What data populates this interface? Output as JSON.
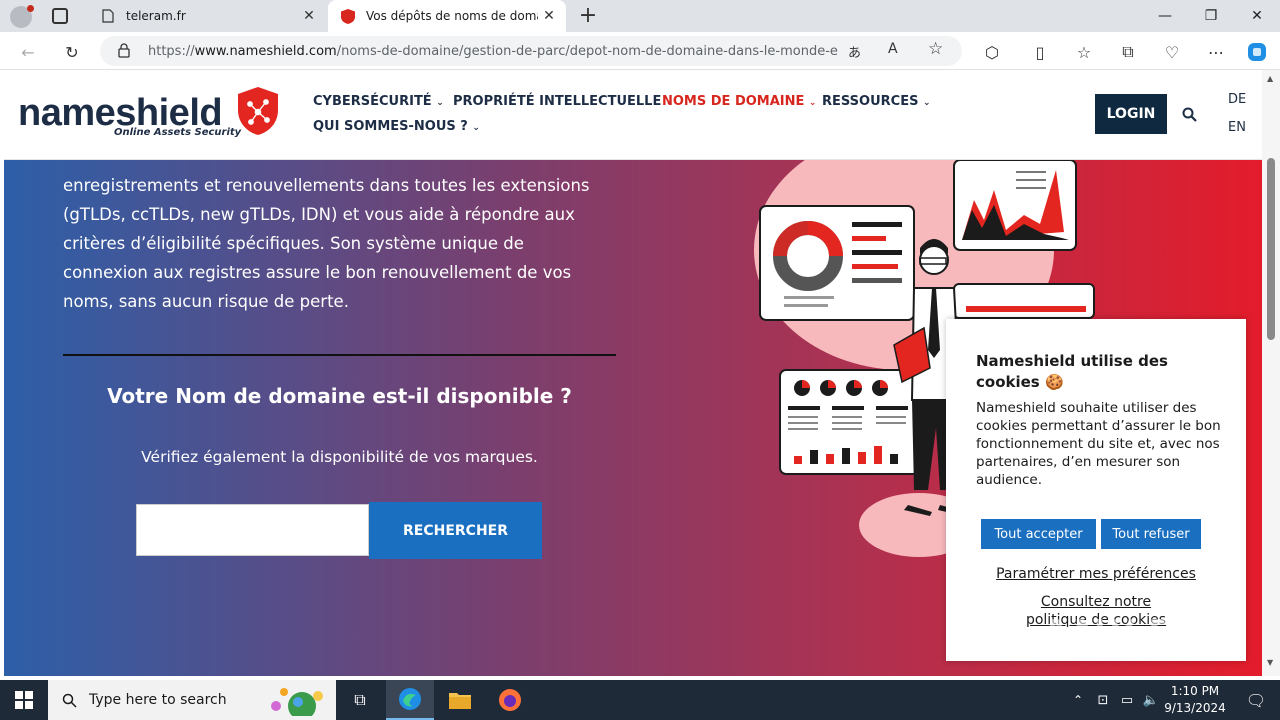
{
  "browser": {
    "tabs": [
      {
        "title": "teleram.fr",
        "active": false
      },
      {
        "title": "Vos dépôts de noms de domaine",
        "active": true
      }
    ],
    "new_tab": "+",
    "url_prefix": "https://",
    "url_domain": "www.nameshield.com",
    "url_path": "/noms-de-domaine/gestion-de-parc/depot-nom-de-domaine-dans-le-monde-ent..."
  },
  "header": {
    "logo_bold": "name",
    "logo_rest": "shield",
    "logo_tagline": "Online Assets Security",
    "menu": [
      {
        "label": "CYBERSÉCURITÉ",
        "active": false
      },
      {
        "label": "PROPRIÉTÉ INTELLECTUELLE",
        "active": false
      },
      {
        "label": "NOMS DE DOMAINE",
        "active": true
      },
      {
        "label": "RESSOURCES",
        "active": false
      },
      {
        "label": "QUI SOMMES-NOUS ?",
        "active": false
      }
    ],
    "login": "LOGIN",
    "lang_de": "DE",
    "lang_en": "EN"
  },
  "hero": {
    "paragraph": "... enregistrements et renouvellements dans toutes les extensions (gTLDs, ccTLDs, new gTLDs, IDN) et vous aide à répondre aux critères d'éligibilité spécifiques. Son système unique de connexion aux registres assure le bon renouvellement de vos noms, sans aucun risque de perte.",
    "line1": "enregistrements et renouvellements dans toutes les extensions",
    "line2": "(gTLDs, ccTLDs, new gTLDs, IDN) et vous aide à répondre aux",
    "line3": "critères d’éligibilité spécifiques. Son système unique de",
    "line4": "connexion aux registres assure le bon renouvellement de vos",
    "line5": "noms, sans aucun risque de perte.",
    "question": "Votre Nom de domaine est-il disponible ?",
    "subtitle": "Vérifiez également la disponibilité de vos marques.",
    "input_value": "",
    "search_button": "RECHERCHER"
  },
  "cookie": {
    "title": "Nameshield utilise des cookies 🍪",
    "body": "Nameshield souhaite utiliser des cookies permettant d’assurer le bon fonctionnement du site et, avec nos partenaires, d’en mesurer son audience.",
    "accept": "Tout accepter",
    "refuse": "Tout refuser",
    "settings": "Paramétrer mes préférences",
    "policy": "Consultez notre politique de cookies"
  },
  "watermark": "ANY.RUN",
  "taskbar": {
    "search_placeholder": "Type here to search",
    "time": "1:10 PM",
    "date": "9/13/2024"
  },
  "colors": {
    "brand_navy": "#1d2d45",
    "brand_red": "#d7261e",
    "button_blue": "#1a6fc1"
  }
}
